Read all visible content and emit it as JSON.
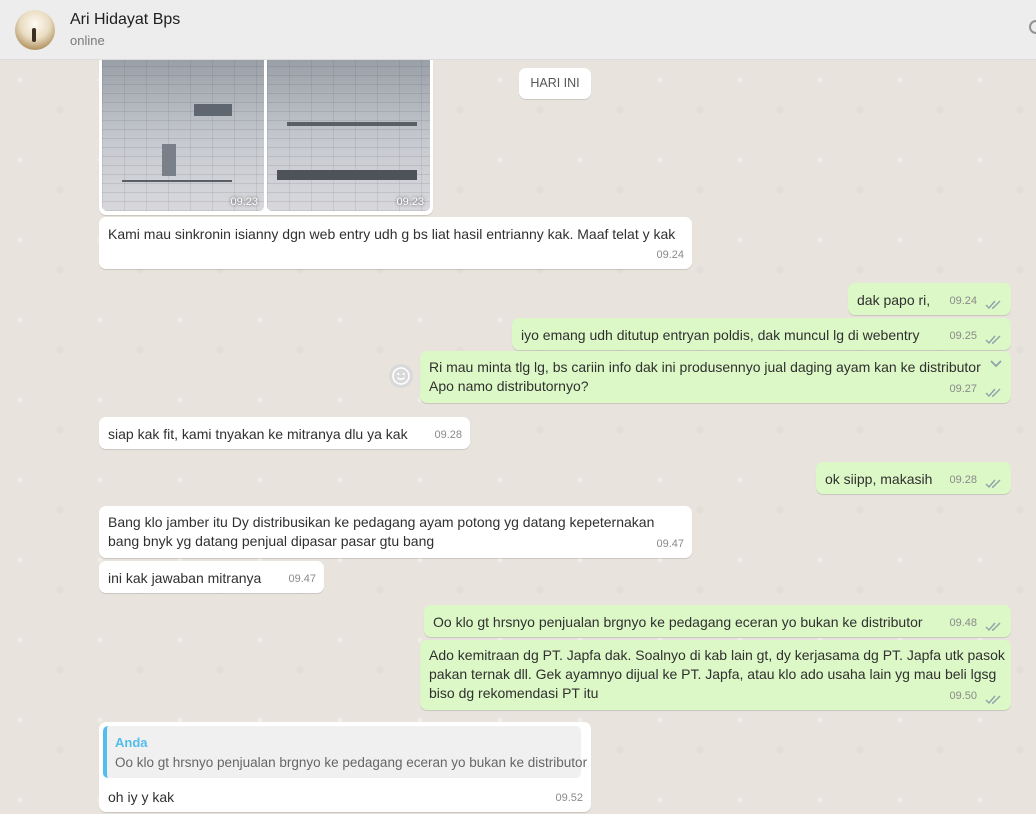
{
  "header": {
    "contact_name": "Ari Hidayat Bps",
    "status": "online"
  },
  "date_separator": "HARI INI",
  "image_message": {
    "times": [
      "09.23",
      "09.23"
    ]
  },
  "messages": [
    {
      "dir": "in",
      "text": "Kami mau sinkronin isianny dgn web entry udh g bs liat hasil entrianny kak. Maaf telat y kak",
      "time": "09.24"
    },
    {
      "dir": "out",
      "text": "dak papo ri,",
      "time": "09.24"
    },
    {
      "dir": "out",
      "text": "iyo emang udh ditutup entryan poldis, dak muncul lg di webentry",
      "time": "09.25"
    },
    {
      "dir": "out",
      "text": "Ri mau minta tlg lg, bs cariin info dak ini produsennyo jual daging ayam kan ke distributor",
      "text2": "Apo namo distributornyo?",
      "time": "09.27"
    },
    {
      "dir": "in",
      "text": "siap kak fit, kami tnyakan ke mitranya dlu ya kak",
      "time": "09.28"
    },
    {
      "dir": "out",
      "text": "ok siipp, makasih",
      "time": "09.28"
    },
    {
      "dir": "in",
      "text": "Bang klo jamber itu Dy distribusikan ke pedagang ayam potong yg datang kepeternakan",
      "text2": "bang bnyk yg datang penjual dipasar pasar gtu bang",
      "time": "09.47"
    },
    {
      "dir": "in",
      "text": "ini kak jawaban mitranya",
      "time": "09.47"
    },
    {
      "dir": "out",
      "text": "Oo klo gt hrsnyo penjualan brgnyo ke pedagang eceran yo bukan ke distributor",
      "time": "09.48"
    },
    {
      "dir": "out",
      "text": "Ado kemitraan dg PT. Japfa dak. Soalnyo di kab lain gt, dy kerjasama dg PT. Japfa utk pasok",
      "text2": "pakan ternak dll. Gek ayamnyo dijual ke PT. Japfa, atau klo ado usaha lain yg mau beli lgsg",
      "text3": "biso dg rekomendasi PT itu",
      "time": "09.50"
    },
    {
      "dir": "in",
      "text": "oh iy y kak",
      "time": "09.52",
      "reply_name": "Anda",
      "reply_text": "Oo klo gt hrsnyo penjualan brgnyo ke pedagang eceran yo bukan ke distributor"
    }
  ],
  "colors": {
    "outgoing_bubble": "#dcf8c6",
    "incoming_bubble": "#ffffff",
    "read_ticks": "#4fc3f7",
    "chat_background": "#e8e3dc"
  }
}
